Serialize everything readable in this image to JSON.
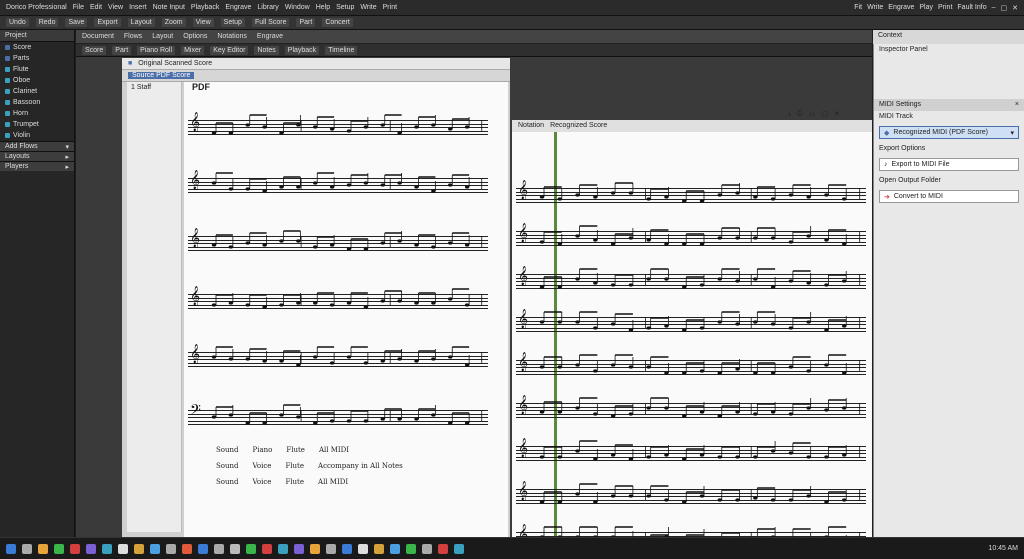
{
  "app": {
    "menubar": {
      "items": [
        "Dorico Professional",
        "File",
        "Edit",
        "View",
        "Insert",
        "Note Input",
        "Playback",
        "Engrave",
        "Library",
        "Window",
        "Help",
        "Setup",
        "Write",
        "Print"
      ],
      "right": [
        "Fit",
        "Write",
        "Engrave",
        "Play",
        "Print"
      ],
      "clock": "Fault Info"
    },
    "toolbar": {
      "items": [
        "Undo",
        "Redo",
        "Save",
        "Export",
        "Layout",
        "Zoom",
        "View",
        "Setup",
        "Full Score",
        "Part",
        "Concert"
      ]
    }
  },
  "left_panel": {
    "header": "Project",
    "items": [
      {
        "label": "Score",
        "color": "#4a6ea8"
      },
      {
        "label": "Parts",
        "color": "#4a6ea8"
      },
      {
        "label": "Flute",
        "color": "#3aa0c0"
      },
      {
        "label": "Oboe",
        "color": "#3aa0c0"
      },
      {
        "label": "Clarinet",
        "color": "#3aa0c0"
      },
      {
        "label": "Bassoon",
        "color": "#3aa0c0"
      },
      {
        "label": "Horn",
        "color": "#3aa0c0"
      },
      {
        "label": "Trumpet",
        "color": "#3aa0c0"
      },
      {
        "label": "Violin",
        "color": "#3aa0c0"
      }
    ],
    "sections": [
      {
        "label": "Add Flows",
        "chev": "▾"
      },
      {
        "label": "Layouts",
        "chev": "▸"
      },
      {
        "label": "Players",
        "chev": "▸"
      }
    ]
  },
  "main": {
    "tabs1": [
      "Document",
      "Flows",
      "Layout",
      "Options",
      "Notations",
      "Engrave"
    ],
    "tabs2": [
      "Score",
      "Part",
      "Piano Roll",
      "Mixer",
      "Key Editor",
      "Notes",
      "Playback",
      "Timeline"
    ],
    "doc_left": {
      "title": "PDF",
      "tab": "Source PDF Score",
      "side": "1 Staff",
      "header": "Original Scanned Score"
    },
    "doc_right": {
      "title": "Notation",
      "sub": "Recognized Score"
    },
    "footer_rows": [
      [
        "Sound",
        "Piano",
        "Flute",
        "All MIDI"
      ],
      [
        "Sound",
        "Voice",
        "Flute",
        "Accompany in All Notes"
      ],
      [
        "Sound",
        "Voice",
        "Flute",
        "All MIDI"
      ]
    ],
    "clefs_left": [
      "𝄞",
      "𝄞",
      "𝄞",
      "𝄞",
      "𝄞",
      "𝄢"
    ],
    "clefs_right": [
      "𝄞",
      "𝄞",
      "𝄞",
      "𝄞",
      "𝄞",
      "𝄞",
      "𝄞",
      "𝄞",
      "𝄞"
    ]
  },
  "right_panel": {
    "top_title": "Context",
    "top_sub": "Inspector Panel",
    "title": "MIDI Settings",
    "sub": "MIDI Track",
    "select": "Recognized MIDI (PDF Score)",
    "rows": [
      "Export Options",
      "Export to MIDI File",
      "Open Output Folder",
      "Convert to MIDI"
    ],
    "close": "×"
  },
  "taskbar": {
    "icons": [
      "#3a7bd5",
      "#aaa",
      "#e8a33a",
      "#3ab54a",
      "#d23f3f",
      "#7a5fd5",
      "#3aa0c0",
      "#ddd",
      "#d5a13a",
      "#4a9fe0",
      "#aaa",
      "#e05a3a",
      "#3a7bd5",
      "#aaa",
      "#bbb",
      "#3ab54a",
      "#d23f3f",
      "#3aa0c0",
      "#7a5fd5",
      "#e8a33a",
      "#aaa",
      "#3a7bd5",
      "#ddd",
      "#d5a13a",
      "#4a9fe0",
      "#3ab54a",
      "#aaa",
      "#d23f3f",
      "#3aa0c0"
    ],
    "tray": "10:45 AM"
  }
}
